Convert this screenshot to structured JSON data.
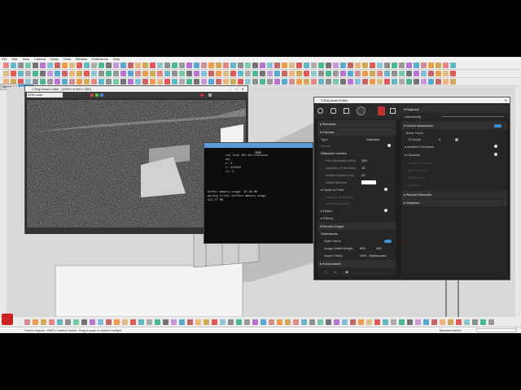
{
  "menu": [
    "File",
    "Edit",
    "View",
    "Camera",
    "Draw",
    "Tools",
    "Window",
    "Extensions",
    "Help"
  ],
  "scene_tabs": [
    "Scene 1",
    "Scene 2"
  ],
  "vfb": {
    "title": "V-Ray frame buffer - [100% of 400 x 450]",
    "channel": "RGB color"
  },
  "console": {
    "header": "RAY",
    "lines": [
      "res took 464 milliseconds",
      "e8)",
      "s: 2",
      "s: 533424",
      "rs: 0",
      "",
      "",
      "buffer memory usage: 15.18 MB",
      "mpling filter buffers memory usage:",
      "113.77 MB"
    ]
  },
  "asset_editor": {
    "title": "V-Ray Asset Editor",
    "left": {
      "renderer": "Renderer",
      "camera": "Camera",
      "type_label": "Type",
      "type_value": "Standard",
      "stereo_label": "Stereo",
      "standard_camera": "Standard Camera",
      "fields": [
        {
          "label": "Film Sensitivity (ISO)",
          "value": "100"
        },
        {
          "label": "Aperture (F-Number)",
          "value": "16"
        },
        {
          "label": "Shutter Speed (1/s)",
          "value": "20"
        },
        {
          "label": "White Balance",
          "value": ""
        }
      ],
      "dof": "Depth of Field",
      "dof_fields": [
        "Defocus (Distance)",
        "Fine Focal Point"
      ],
      "bokeh": "Bokeh",
      "effects": "Effects",
      "render_output": "Render Output",
      "dimensions": "Dimensions",
      "safe_frame": "Safe Frame",
      "image_label": "Image Width/Height",
      "image_w": "800",
      "image_h": "450",
      "aspect_label": "Aspect Ratio",
      "aspect_value": "HLR - Widescreen",
      "environment": "Environment"
    },
    "right": {
      "raytrace": "Raytrace",
      "interactivity": "Interactivity",
      "gi": "Global Illumination",
      "brute_force": "Brute Force",
      "gi_depth_label": "GI Depth",
      "gi_depth": "3",
      "ao": "Ambient Occlusion",
      "caustics": "Caustics",
      "caustics_fields": [
        "Search Distance",
        "Max Photons",
        "Max Density",
        "Multiplier"
      ],
      "render_elements": "Render Elements",
      "switches": "Switches"
    }
  },
  "statusbar": {
    "text": "Select objects. Shift to extend select. Drag mouse to select multiple.",
    "measurements": "Measurements"
  },
  "colors": {
    "accent": "#3d8fd1",
    "console_title": "#5b9bd5"
  }
}
